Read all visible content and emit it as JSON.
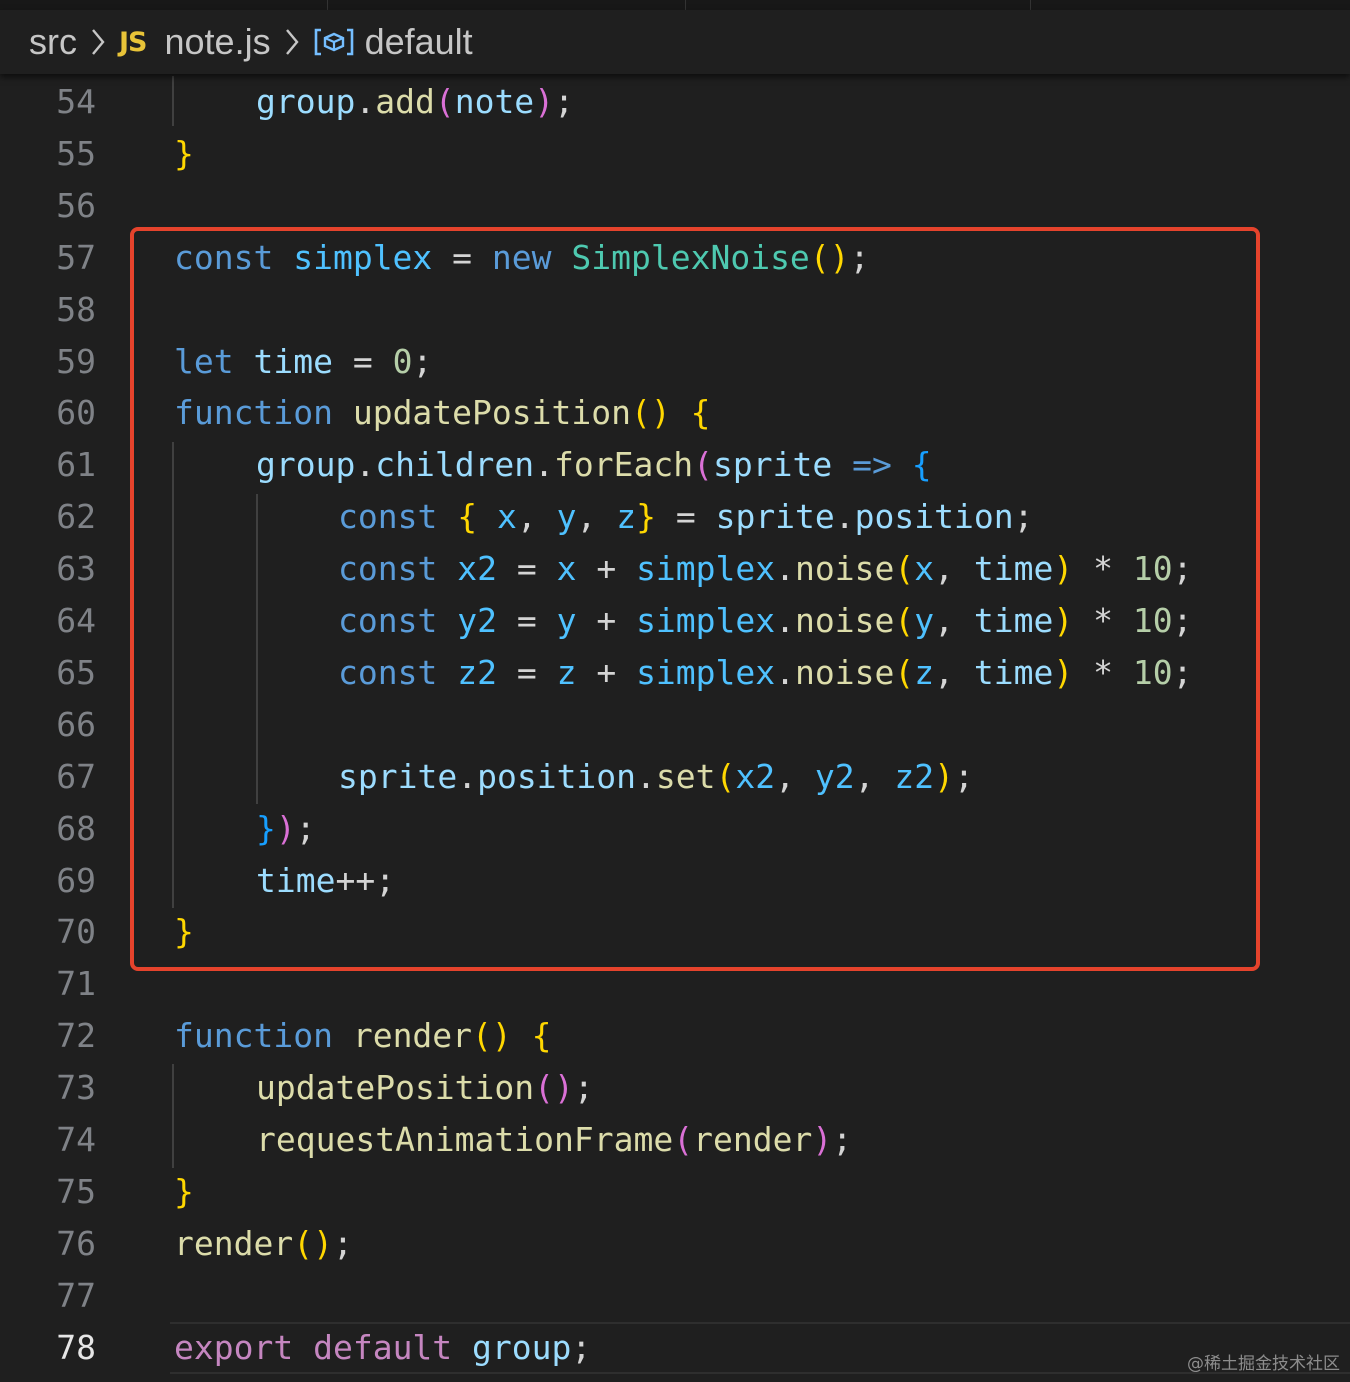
{
  "breadcrumb": {
    "folder": "src",
    "file_badge": "JS",
    "file": "note.js",
    "symbol": "default"
  },
  "current_line": "78",
  "lines": [
    {
      "n": "54",
      "indent": 1,
      "tokens": [
        [
          "var",
          "group"
        ],
        [
          "pl",
          "."
        ],
        [
          "fn",
          "add"
        ],
        [
          "b2",
          "("
        ],
        [
          "var",
          "note"
        ],
        [
          "b2",
          ")"
        ],
        [
          "pl",
          ";"
        ]
      ]
    },
    {
      "n": "55",
      "indent": 0,
      "tokens": [
        [
          "b1",
          "}"
        ]
      ]
    },
    {
      "n": "56",
      "indent": 0,
      "tokens": []
    },
    {
      "n": "57",
      "indent": 0,
      "tokens": [
        [
          "kw",
          "const"
        ],
        [
          "pl",
          " "
        ],
        [
          "cst",
          "simplex"
        ],
        [
          "op",
          " = "
        ],
        [
          "kw",
          "new"
        ],
        [
          "pl",
          " "
        ],
        [
          "cls",
          "SimplexNoise"
        ],
        [
          "b1",
          "()"
        ],
        [
          "pl",
          ";"
        ]
      ]
    },
    {
      "n": "58",
      "indent": 0,
      "tokens": []
    },
    {
      "n": "59",
      "indent": 0,
      "tokens": [
        [
          "kw",
          "let"
        ],
        [
          "pl",
          " "
        ],
        [
          "var",
          "time"
        ],
        [
          "op",
          " = "
        ],
        [
          "num",
          "0"
        ],
        [
          "pl",
          ";"
        ]
      ]
    },
    {
      "n": "60",
      "indent": 0,
      "tokens": [
        [
          "kw",
          "function"
        ],
        [
          "pl",
          " "
        ],
        [
          "fn",
          "updatePosition"
        ],
        [
          "b1",
          "()"
        ],
        [
          "pl",
          " "
        ],
        [
          "b1",
          "{"
        ]
      ]
    },
    {
      "n": "61",
      "indent": 1,
      "tokens": [
        [
          "var",
          "group"
        ],
        [
          "pl",
          "."
        ],
        [
          "var",
          "children"
        ],
        [
          "pl",
          "."
        ],
        [
          "fn",
          "forEach"
        ],
        [
          "b2",
          "("
        ],
        [
          "var",
          "sprite"
        ],
        [
          "pl",
          " "
        ],
        [
          "kw",
          "=>"
        ],
        [
          "pl",
          " "
        ],
        [
          "b3",
          "{"
        ]
      ]
    },
    {
      "n": "62",
      "indent": 2,
      "tokens": [
        [
          "kw",
          "const"
        ],
        [
          "pl",
          " "
        ],
        [
          "b1",
          "{"
        ],
        [
          "pl",
          " "
        ],
        [
          "cst",
          "x"
        ],
        [
          "pl",
          ", "
        ],
        [
          "cst",
          "y"
        ],
        [
          "pl",
          ", "
        ],
        [
          "cst",
          "z"
        ],
        [
          "b1",
          "}"
        ],
        [
          "op",
          " = "
        ],
        [
          "var",
          "sprite"
        ],
        [
          "pl",
          "."
        ],
        [
          "var",
          "position"
        ],
        [
          "pl",
          ";"
        ]
      ]
    },
    {
      "n": "63",
      "indent": 2,
      "tokens": [
        [
          "kw",
          "const"
        ],
        [
          "pl",
          " "
        ],
        [
          "cst",
          "x2"
        ],
        [
          "op",
          " = "
        ],
        [
          "cst",
          "x"
        ],
        [
          "op",
          " + "
        ],
        [
          "cst",
          "simplex"
        ],
        [
          "pl",
          "."
        ],
        [
          "fn",
          "noise"
        ],
        [
          "b1",
          "("
        ],
        [
          "cst",
          "x"
        ],
        [
          "pl",
          ", "
        ],
        [
          "var",
          "time"
        ],
        [
          "b1",
          ")"
        ],
        [
          "op",
          " * "
        ],
        [
          "num",
          "10"
        ],
        [
          "pl",
          ";"
        ]
      ]
    },
    {
      "n": "64",
      "indent": 2,
      "tokens": [
        [
          "kw",
          "const"
        ],
        [
          "pl",
          " "
        ],
        [
          "cst",
          "y2"
        ],
        [
          "op",
          " = "
        ],
        [
          "cst",
          "y"
        ],
        [
          "op",
          " + "
        ],
        [
          "cst",
          "simplex"
        ],
        [
          "pl",
          "."
        ],
        [
          "fn",
          "noise"
        ],
        [
          "b1",
          "("
        ],
        [
          "cst",
          "y"
        ],
        [
          "pl",
          ", "
        ],
        [
          "var",
          "time"
        ],
        [
          "b1",
          ")"
        ],
        [
          "op",
          " * "
        ],
        [
          "num",
          "10"
        ],
        [
          "pl",
          ";"
        ]
      ]
    },
    {
      "n": "65",
      "indent": 2,
      "tokens": [
        [
          "kw",
          "const"
        ],
        [
          "pl",
          " "
        ],
        [
          "cst",
          "z2"
        ],
        [
          "op",
          " = "
        ],
        [
          "cst",
          "z"
        ],
        [
          "op",
          " + "
        ],
        [
          "cst",
          "simplex"
        ],
        [
          "pl",
          "."
        ],
        [
          "fn",
          "noise"
        ],
        [
          "b1",
          "("
        ],
        [
          "cst",
          "z"
        ],
        [
          "pl",
          ", "
        ],
        [
          "var",
          "time"
        ],
        [
          "b1",
          ")"
        ],
        [
          "op",
          " * "
        ],
        [
          "num",
          "10"
        ],
        [
          "pl",
          ";"
        ]
      ]
    },
    {
      "n": "66",
      "indent": 0,
      "tokens": []
    },
    {
      "n": "67",
      "indent": 2,
      "tokens": [
        [
          "var",
          "sprite"
        ],
        [
          "pl",
          "."
        ],
        [
          "var",
          "position"
        ],
        [
          "pl",
          "."
        ],
        [
          "fn",
          "set"
        ],
        [
          "b1",
          "("
        ],
        [
          "cst",
          "x2"
        ],
        [
          "pl",
          ", "
        ],
        [
          "cst",
          "y2"
        ],
        [
          "pl",
          ", "
        ],
        [
          "cst",
          "z2"
        ],
        [
          "b1",
          ")"
        ],
        [
          "pl",
          ";"
        ]
      ]
    },
    {
      "n": "68",
      "indent": 1,
      "tokens": [
        [
          "b3",
          "}"
        ],
        [
          "b2",
          ")"
        ],
        [
          "pl",
          ";"
        ]
      ]
    },
    {
      "n": "69",
      "indent": 1,
      "tokens": [
        [
          "var",
          "time"
        ],
        [
          "op",
          "++"
        ],
        [
          "pl",
          ";"
        ]
      ]
    },
    {
      "n": "70",
      "indent": 0,
      "tokens": [
        [
          "b1",
          "}"
        ]
      ]
    },
    {
      "n": "71",
      "indent": 0,
      "tokens": []
    },
    {
      "n": "72",
      "indent": 0,
      "tokens": [
        [
          "kw",
          "function"
        ],
        [
          "pl",
          " "
        ],
        [
          "fn",
          "render"
        ],
        [
          "b1",
          "()"
        ],
        [
          "pl",
          " "
        ],
        [
          "b1",
          "{"
        ]
      ]
    },
    {
      "n": "73",
      "indent": 1,
      "tokens": [
        [
          "fn",
          "updatePosition"
        ],
        [
          "b2",
          "()"
        ],
        [
          "pl",
          ";"
        ]
      ]
    },
    {
      "n": "74",
      "indent": 1,
      "tokens": [
        [
          "fn",
          "requestAnimationFrame"
        ],
        [
          "b2",
          "("
        ],
        [
          "fn",
          "render"
        ],
        [
          "b2",
          ")"
        ],
        [
          "pl",
          ";"
        ]
      ]
    },
    {
      "n": "75",
      "indent": 0,
      "tokens": [
        [
          "b1",
          "}"
        ]
      ]
    },
    {
      "n": "76",
      "indent": 0,
      "tokens": [
        [
          "fn",
          "render"
        ],
        [
          "b1",
          "()"
        ],
        [
          "pl",
          ";"
        ]
      ]
    },
    {
      "n": "77",
      "indent": 0,
      "tokens": []
    },
    {
      "n": "78",
      "indent": 0,
      "tokens": [
        [
          "kwc",
          "export"
        ],
        [
          "pl",
          " "
        ],
        [
          "kwc",
          "default"
        ],
        [
          "pl",
          " "
        ],
        [
          "var",
          "group"
        ],
        [
          "pl",
          ";"
        ]
      ]
    }
  ],
  "watermark": "@稀土掘金技术社区"
}
